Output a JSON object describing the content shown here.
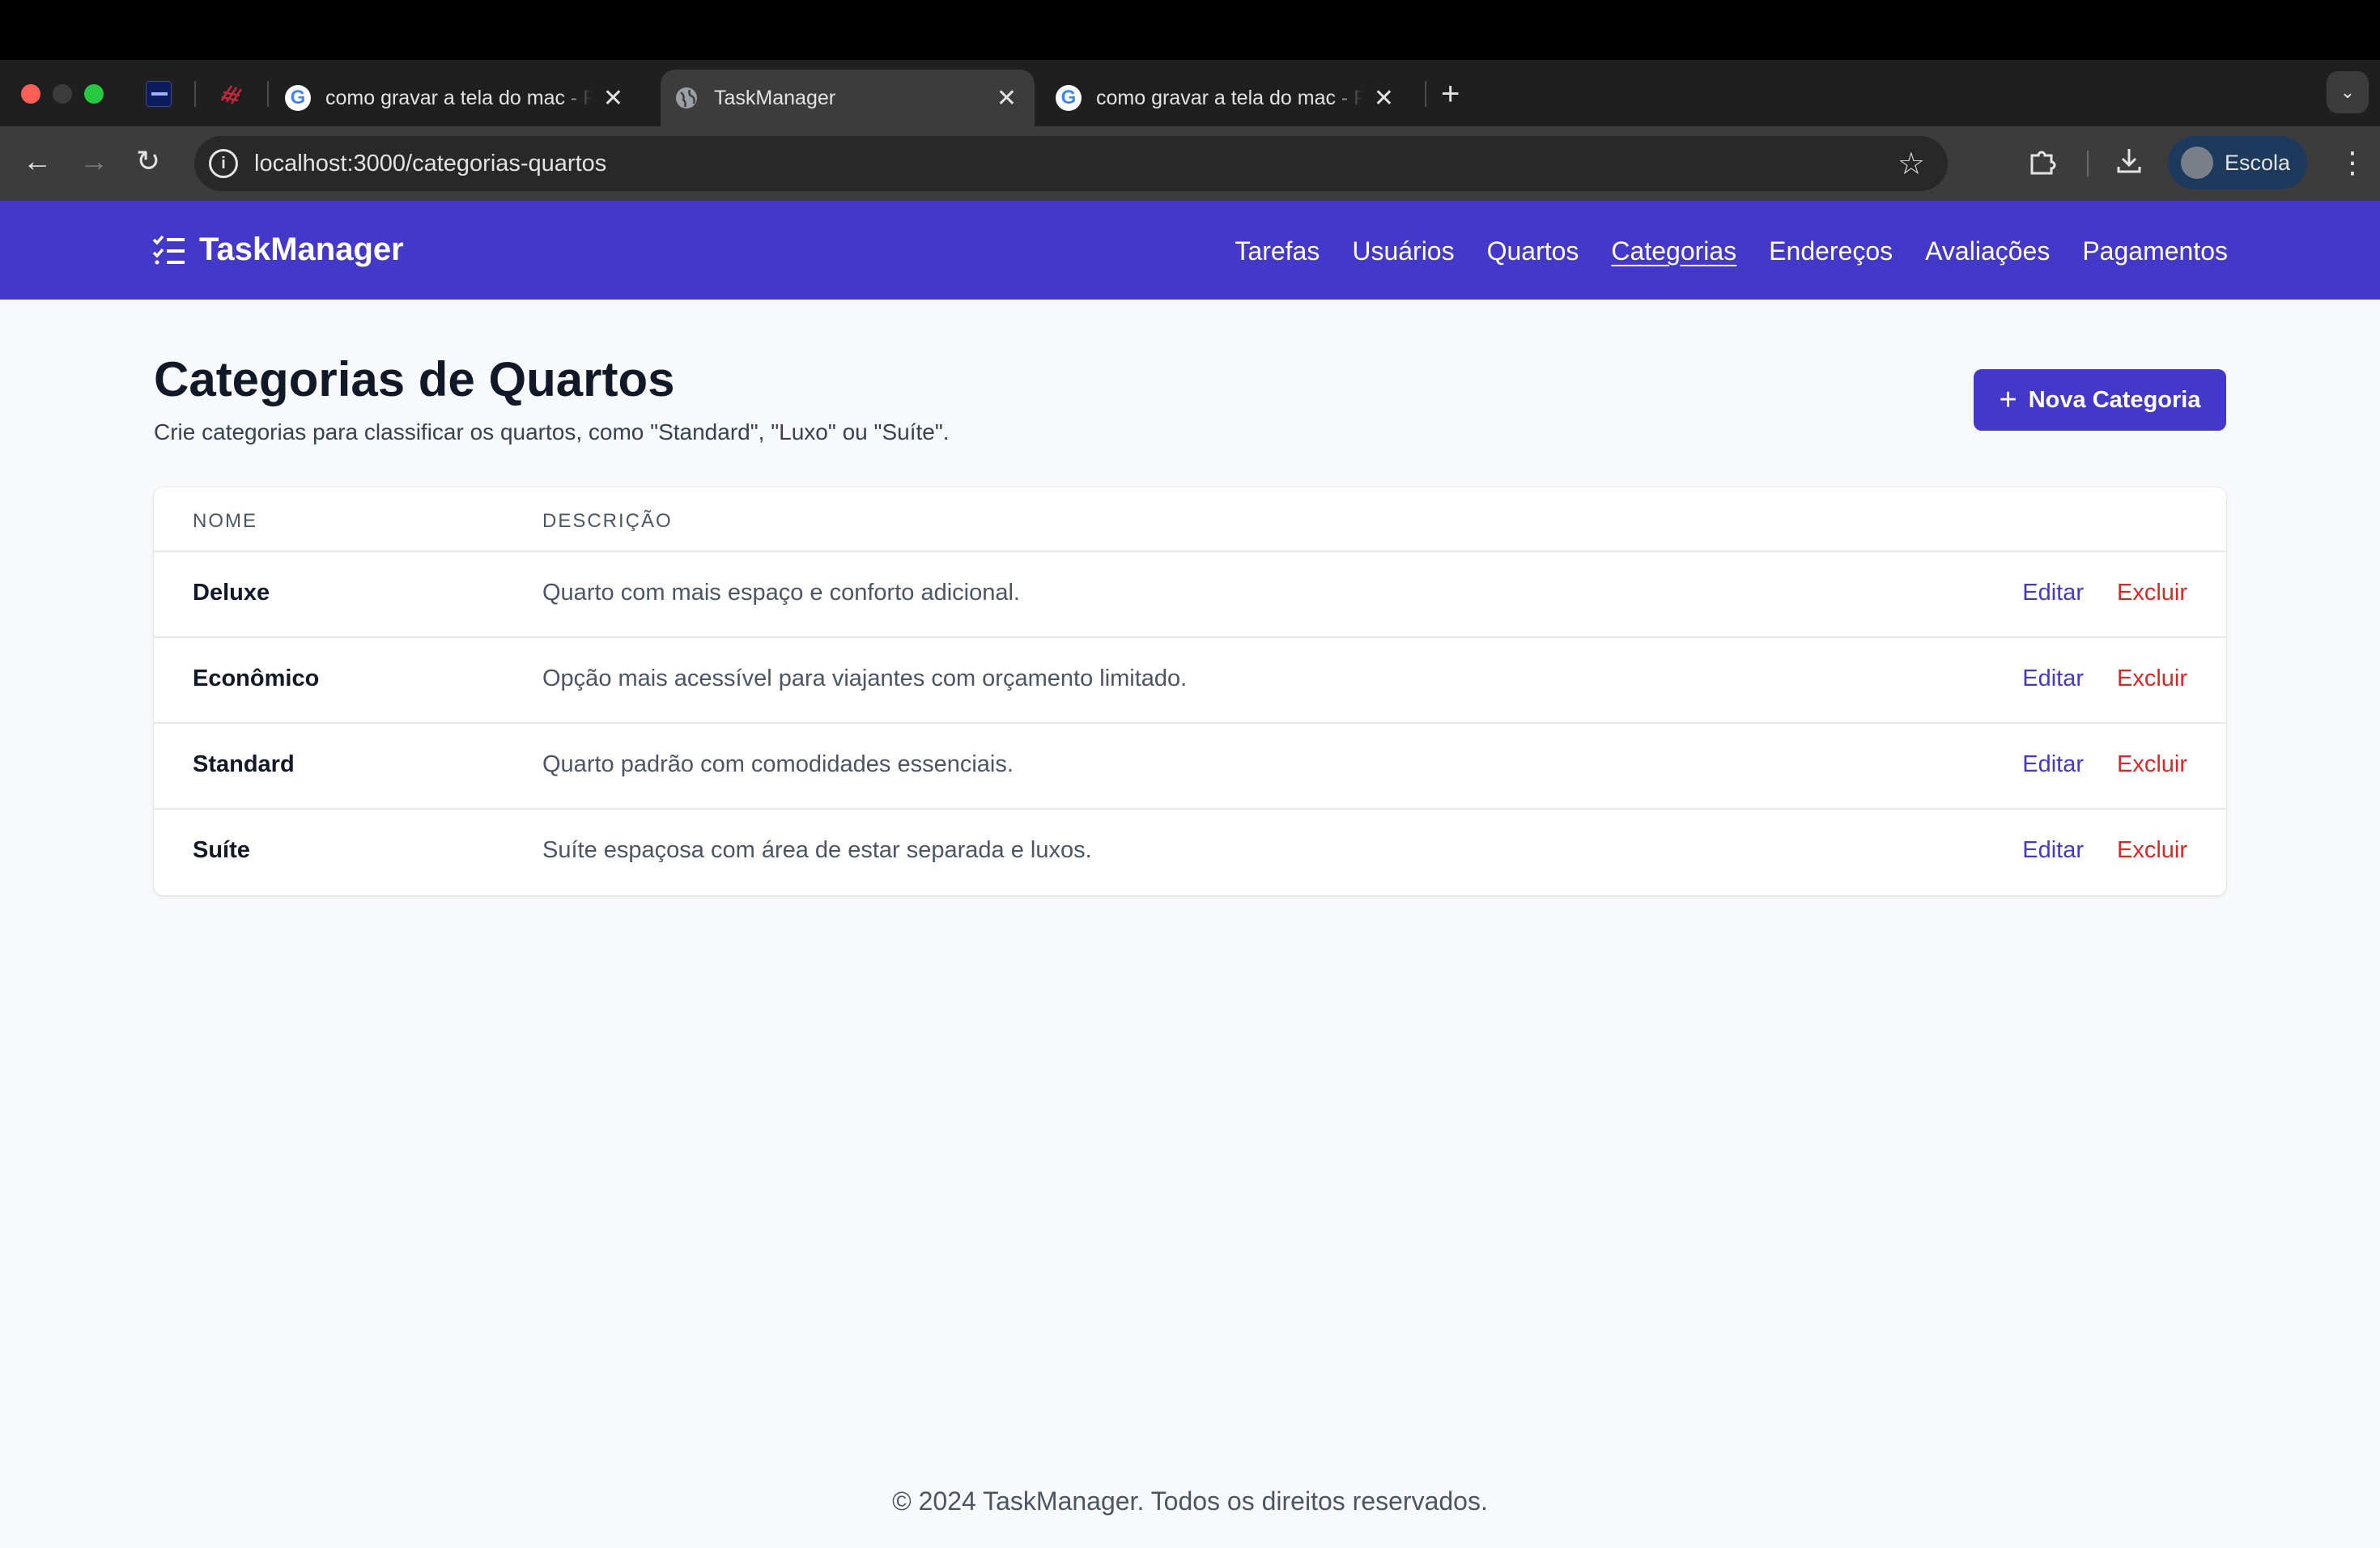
{
  "browser": {
    "tabs": [
      {
        "title": "como gravar a tela do mac - P",
        "favicon": "google-icon"
      },
      {
        "title": "TaskManager",
        "favicon": "globe-icon",
        "active": true
      },
      {
        "title": "como gravar a tela do mac - P",
        "favicon": "google-icon"
      }
    ],
    "url": "localhost:3000/categorias-quartos",
    "profile_name": "Escola"
  },
  "app": {
    "brand": "TaskManager",
    "nav": [
      "Tarefas",
      "Usuários",
      "Quartos",
      "Categorias",
      "Endereços",
      "Avaliações",
      "Pagamentos"
    ],
    "active_nav": "Categorias"
  },
  "page": {
    "title": "Categorias de Quartos",
    "subtitle": "Crie categorias para classificar os quartos, como \"Standard\", \"Luxo\" ou \"Suíte\".",
    "new_button": "Nova Categoria"
  },
  "table": {
    "headers": [
      "NOME",
      "DESCRIÇÃO"
    ],
    "rows": [
      {
        "name": "Deluxe",
        "description": "Quarto com mais espaço e conforto adicional."
      },
      {
        "name": "Econômico",
        "description": "Opção mais acessível para viajantes com orçamento limitado."
      },
      {
        "name": "Standard",
        "description": "Quarto padrão com comodidades essenciais."
      },
      {
        "name": "Suíte",
        "description": "Suíte espaçosa com área de estar separada e luxos."
      }
    ],
    "edit_label": "Editar",
    "delete_label": "Excluir"
  },
  "footer": "© 2024 TaskManager. Todos os direitos reservados.",
  "colors": {
    "primary": "#4338ca",
    "danger": "#dc2626",
    "background": "#f8f9fb"
  }
}
